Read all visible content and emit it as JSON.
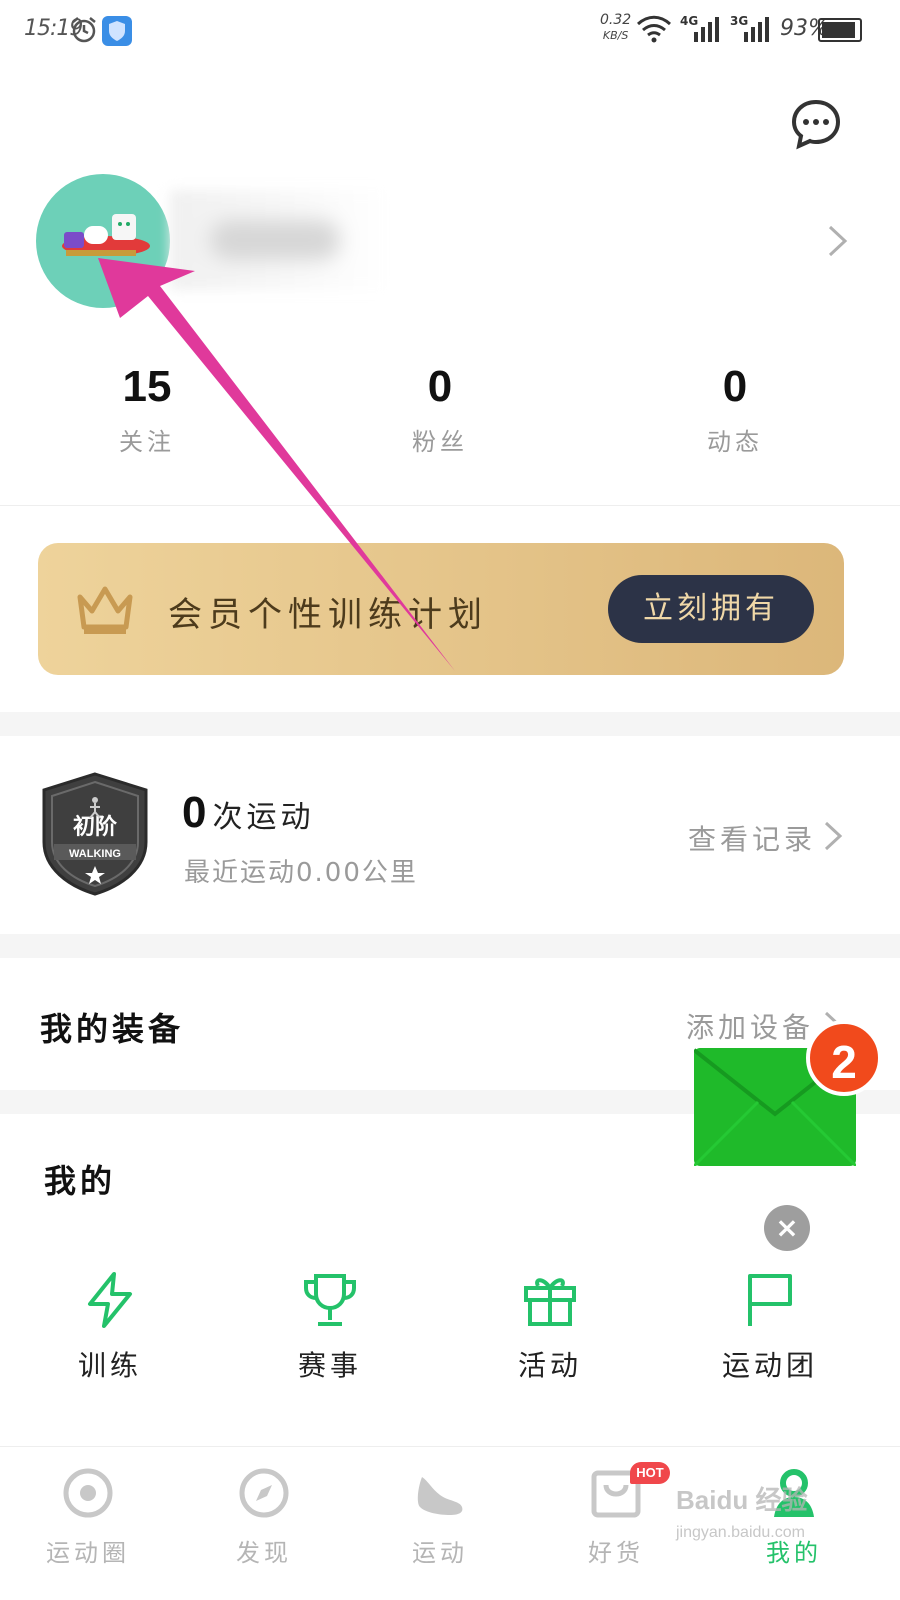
{
  "status_bar": {
    "time": "15:19",
    "net_speed_value": "0.32",
    "net_speed_unit": "KB/S",
    "net_4g": "4G",
    "net_3g": "3G",
    "battery": "93%",
    "battery_level": 0.93,
    "icons": [
      "alarm-icon",
      "shield-icon",
      "wifi-icon",
      "signal-4g-icon",
      "signal-3g-icon",
      "battery-icon"
    ]
  },
  "header": {
    "message_icon": "chat-bubble-icon"
  },
  "profile": {
    "avatar_icon": "avatar-image",
    "stats": [
      {
        "value": "15",
        "label": "关注"
      },
      {
        "value": "0",
        "label": "粉丝"
      },
      {
        "value": "0",
        "label": "动态"
      }
    ]
  },
  "vip_banner": {
    "text": "会员个性训练计划",
    "button": "立刻拥有",
    "icon": "crown-icon"
  },
  "workout": {
    "badge_title": "初阶",
    "badge_sub": "WALKING",
    "count": "0",
    "count_unit": "次运动",
    "recent": "最近运动0.00公里",
    "view_records": "查看记录"
  },
  "equipment": {
    "title": "我的装备",
    "add_device": "添加设备"
  },
  "floating_mail": {
    "badge": "2",
    "close": "×"
  },
  "mine": {
    "title": "我的",
    "items": [
      {
        "label": "训练",
        "icon": "lightning-icon"
      },
      {
        "label": "赛事",
        "icon": "trophy-icon"
      },
      {
        "label": "活动",
        "icon": "gift-icon"
      },
      {
        "label": "运动团",
        "icon": "flag-icon"
      }
    ]
  },
  "tab_bar": {
    "tabs": [
      {
        "label": "运动圈",
        "icon": "circle-target-icon"
      },
      {
        "label": "发现",
        "icon": "compass-icon"
      },
      {
        "label": "运动",
        "icon": "shoe-icon"
      },
      {
        "label": "好货",
        "icon": "shop-bag-icon",
        "badge": "HOT"
      },
      {
        "label": "我的",
        "icon": "person-icon",
        "active": true
      }
    ]
  },
  "watermark": {
    "main": "Baidu 经验",
    "sub": "jingyan.baidu.com"
  },
  "colors": {
    "accent_green": "#24c26a",
    "vip_gold": "#dcb77a",
    "vip_button": "#2c3347",
    "annotation_arrow": "#e0399b"
  }
}
